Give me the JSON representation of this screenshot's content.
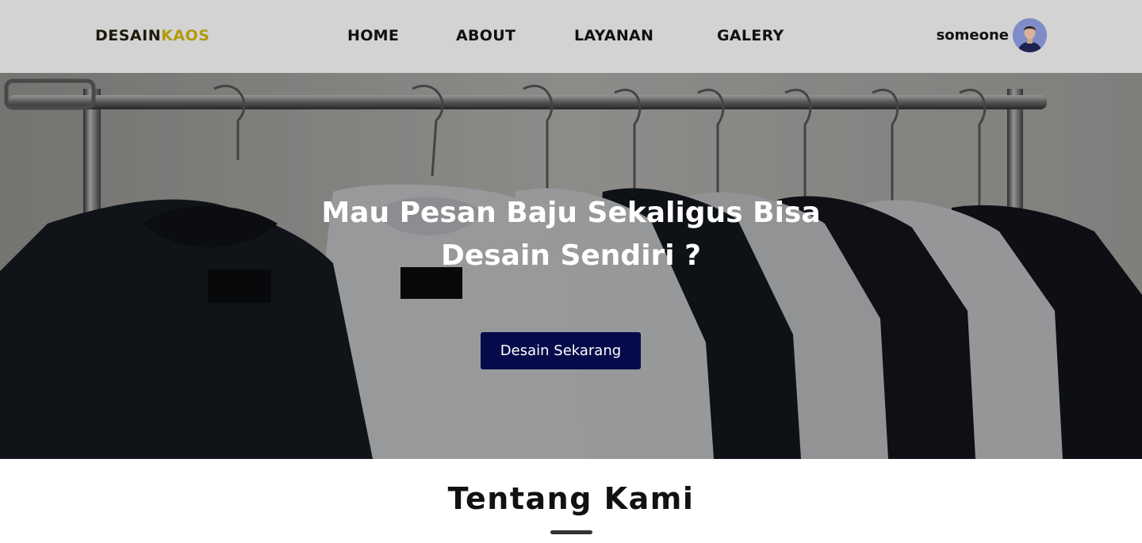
{
  "header": {
    "brand_part1": "DESAIN",
    "brand_part2": "KAOS",
    "nav": [
      {
        "label": "HOME"
      },
      {
        "label": "ABOUT"
      },
      {
        "label": "LAYANAN"
      },
      {
        "label": "GALERY"
      }
    ],
    "user_name": "someone"
  },
  "hero": {
    "title_line1": "Mau Pesan Baju Sekaligus Bisa",
    "title_line2": "Desain Sendiri ?",
    "cta_label": "Desain Sekarang"
  },
  "about": {
    "title": "Tentang Kami"
  },
  "colors": {
    "navbar_bg": "#d3d3d3",
    "brand_accent": "#b39a0c",
    "cta_bg": "#050b4a"
  }
}
